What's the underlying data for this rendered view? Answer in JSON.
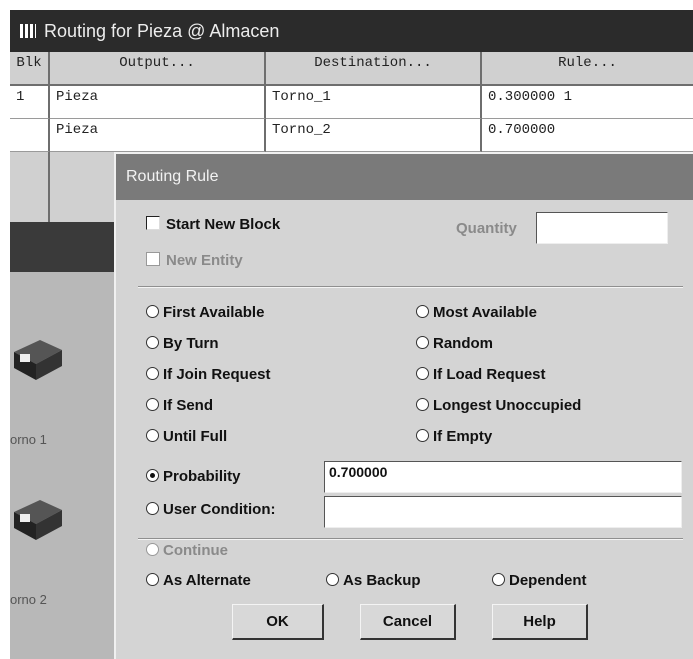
{
  "background_window": {
    "title": "Routing for Pieza @ Almacen",
    "columns": [
      "Blk",
      "Output...",
      "Destination...",
      "Rule..."
    ],
    "rows": [
      {
        "blk": "1",
        "output": "Pieza",
        "destination": "Torno_1",
        "rule": "0.300000 1"
      },
      {
        "blk": "",
        "output": "Pieza",
        "destination": "Torno_2",
        "rule": "0.700000"
      }
    ],
    "machine_labels": [
      "orno 1",
      "orno 2"
    ]
  },
  "dialog": {
    "title": "Routing Rule",
    "start_new_block": {
      "label": "Start New Block",
      "checked": false
    },
    "new_entity": {
      "label": "New Entity",
      "checked": false,
      "disabled": true
    },
    "quantity": {
      "label": "Quantity",
      "value": ""
    },
    "rules_left": [
      "First Available",
      "By Turn",
      "If Join Request",
      "If Send",
      "Until Full"
    ],
    "rules_right": [
      "Most Available",
      "Random",
      "If Load Request",
      "Longest Unoccupied",
      "If Empty"
    ],
    "probability": {
      "label": "Probability",
      "value": "0.700000",
      "selected": true
    },
    "user_condition": {
      "label": "User Condition:",
      "value": ""
    },
    "continue_label": "Continue",
    "alternate_label": "As Alternate",
    "backup_label": "As Backup",
    "dependent_label": "Dependent",
    "buttons": {
      "ok": "OK",
      "cancel": "Cancel",
      "help": "Help"
    }
  },
  "colors": {
    "title_bar": "#2b2b2b",
    "dialog_title": "#7a7a7a",
    "dialog_bg": "#d4d4d4"
  }
}
